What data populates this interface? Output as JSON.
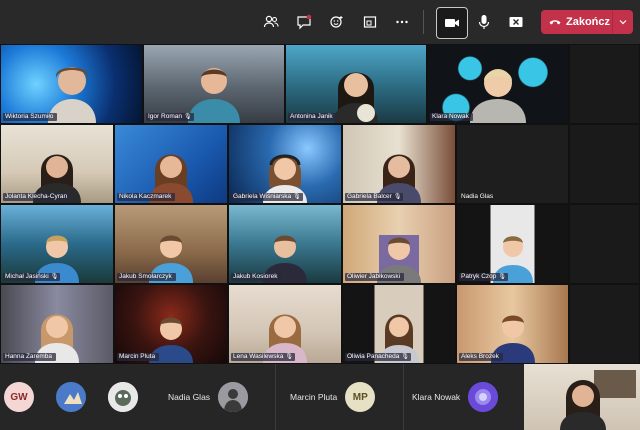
{
  "toolbar": {
    "icons": [
      "people-icon",
      "chat-icon",
      "reactions-icon",
      "share-icon",
      "more-icon",
      "camera-icon",
      "mic-icon",
      "close-share-icon"
    ],
    "end_call_label": "Zakończ",
    "end_call_color": "#c4314b"
  },
  "tiles": [
    {
      "name": "Wiktoria Szumiło",
      "mic": ""
    },
    {
      "name": "Igor Roman",
      "mic": "🎙"
    },
    {
      "name": "Antonina Janik",
      "mic": ""
    },
    {
      "name": "Klara Nowak",
      "mic": ""
    },
    {
      "name": "Jolanta Klecha-Cyran",
      "mic": ""
    },
    {
      "name": "Nikola Kaczmarek",
      "mic": ""
    },
    {
      "name": "Gabriela Wiśniarska",
      "mic": "🎙"
    },
    {
      "name": "Gabriela Balcer",
      "mic": "🎙"
    },
    {
      "name": "Nadia Glas",
      "mic": ""
    },
    {
      "name": "Michał Jasiński",
      "mic": "🎙"
    },
    {
      "name": "Jakub Smołarczyk",
      "mic": ""
    },
    {
      "name": "Jakub Kosiorek",
      "mic": ""
    },
    {
      "name": "Oliwier Jabłkowski",
      "mic": ""
    },
    {
      "name": "Patryk Czop",
      "mic": "🎙"
    },
    {
      "name": "Hanna Zaremba",
      "mic": ""
    },
    {
      "name": "Marcin Pluta",
      "mic": ""
    },
    {
      "name": "Lena Wasilewska",
      "mic": "🎙"
    },
    {
      "name": "Oliwia Panacheda",
      "mic": "🎙"
    },
    {
      "name": "Aleks Brożek",
      "mic": ""
    }
  ],
  "strip": {
    "avatar_gw": "GW",
    "avatar_mp": "MP",
    "name_nadia": "Nadia Glas",
    "name_marcin": "Marcin Pluta",
    "name_klara": "Klara Nowak"
  }
}
